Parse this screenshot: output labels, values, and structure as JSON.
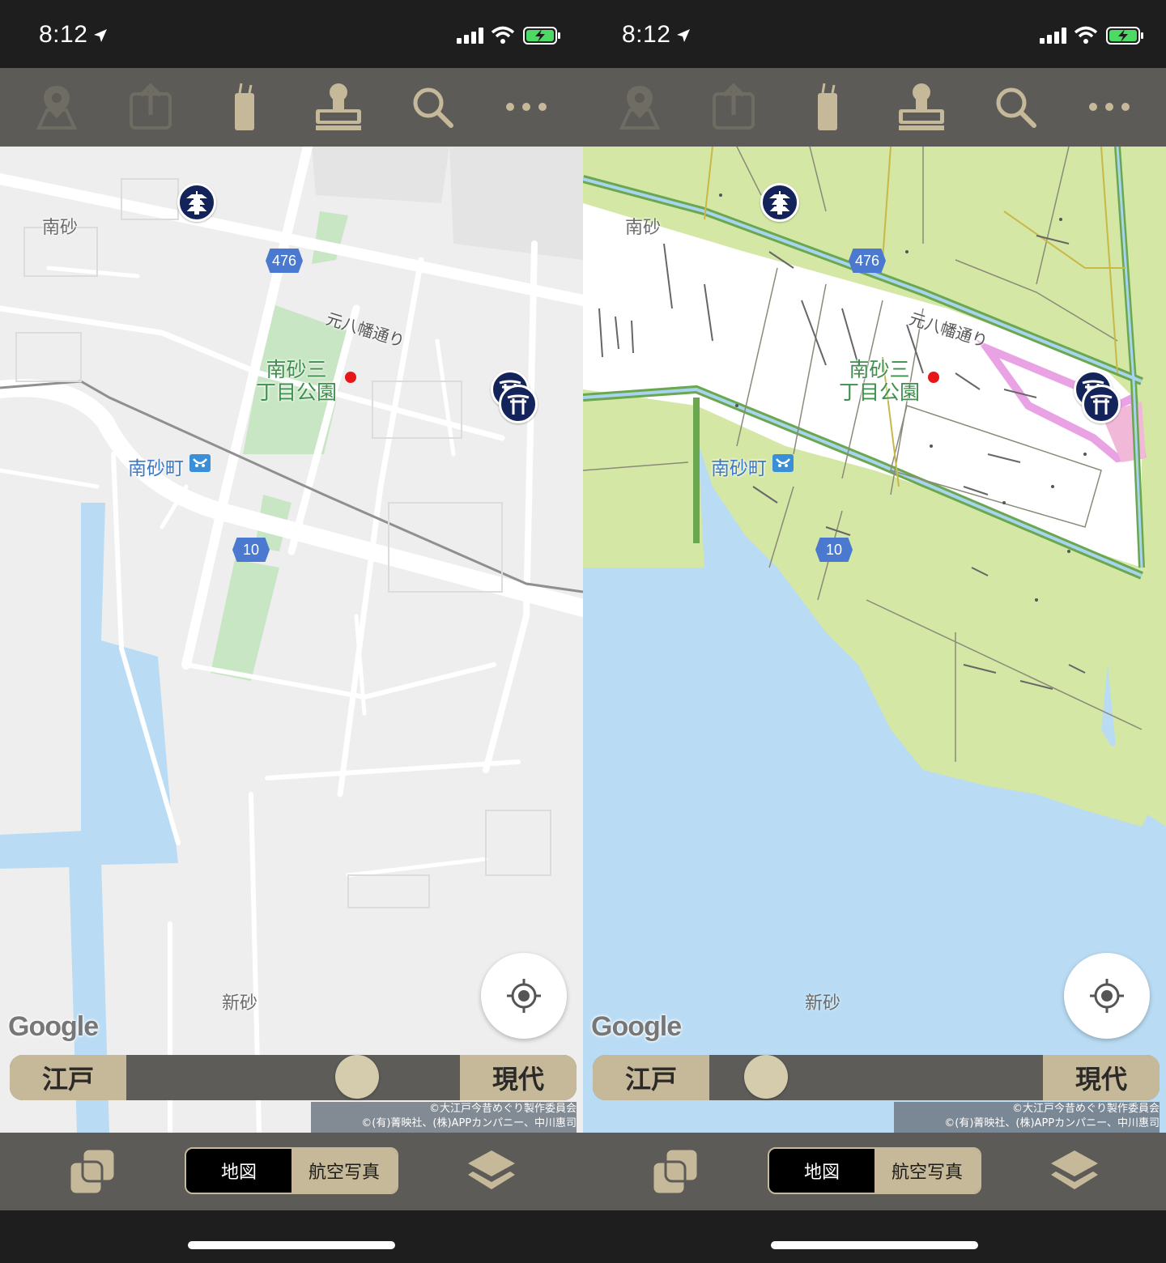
{
  "status_bar": {
    "time": "8:12"
  },
  "toolbar": {
    "icons": [
      "map-pin-icon",
      "share-icon",
      "bookmark-tag-icon",
      "stamp-icon",
      "search-icon",
      "more-icon"
    ]
  },
  "map_labels": {
    "area_north": "南砂",
    "area_south": "新砂",
    "park_line1": "南砂三",
    "park_line2": "丁目公園",
    "road_name": "元八幡通り",
    "station": "南砂町",
    "route_476": "476",
    "route_10": "10",
    "google": "Google"
  },
  "slider": {
    "left_label": "江戸",
    "right_label": "現代"
  },
  "copyright": {
    "line1": "©大江戸今昔めぐり製作委員会",
    "line2": "©(有)菁映社、(株)APPカンパニー、中川惠司"
  },
  "bottom_bar": {
    "segment_map": "地図",
    "segment_aerial": "航空写真"
  },
  "screens": [
    {
      "name": "modern-map",
      "slider_value": 0.72
    },
    {
      "name": "edo-map",
      "slider_value": 0.12
    }
  ],
  "colors": {
    "toolbar_bg": "#5c5b58",
    "accent_tan": "#c6b99a",
    "marker_navy": "#14245a",
    "water": "#b9dcf4",
    "edo_land": "#d4e7a4"
  }
}
